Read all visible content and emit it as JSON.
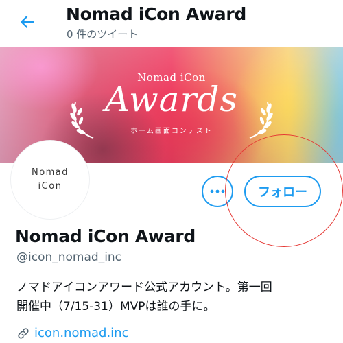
{
  "topbar": {
    "back_icon": "arrow-left-icon",
    "title": "Nomad iCon Award",
    "subtitle": "0 件のツイート"
  },
  "banner": {
    "small_title": "Nomad iCon",
    "big_title": "Awards",
    "caption": "ホーム画面コンテスト",
    "laurel_icon": "laurel-icon"
  },
  "avatar": {
    "line1": "Nomad",
    "line2": "iCon"
  },
  "actions": {
    "more_icon": "more-dots-icon",
    "follow_label": "フォロー"
  },
  "profile": {
    "name": "Nomad iCon Award",
    "handle": "@icon_nomad_inc",
    "bio_line1": "ノマドアイコンアワード公式アカウント。第一回",
    "bio_line2": "開催中（7/15-31）MVPは誰の手に。",
    "link_icon": "link-icon",
    "link_text": "icon.nomad.inc"
  },
  "colors": {
    "accent": "#1d9bf0",
    "annotation": "#e53935",
    "text_primary": "#0f1419",
    "text_secondary": "#536471"
  }
}
